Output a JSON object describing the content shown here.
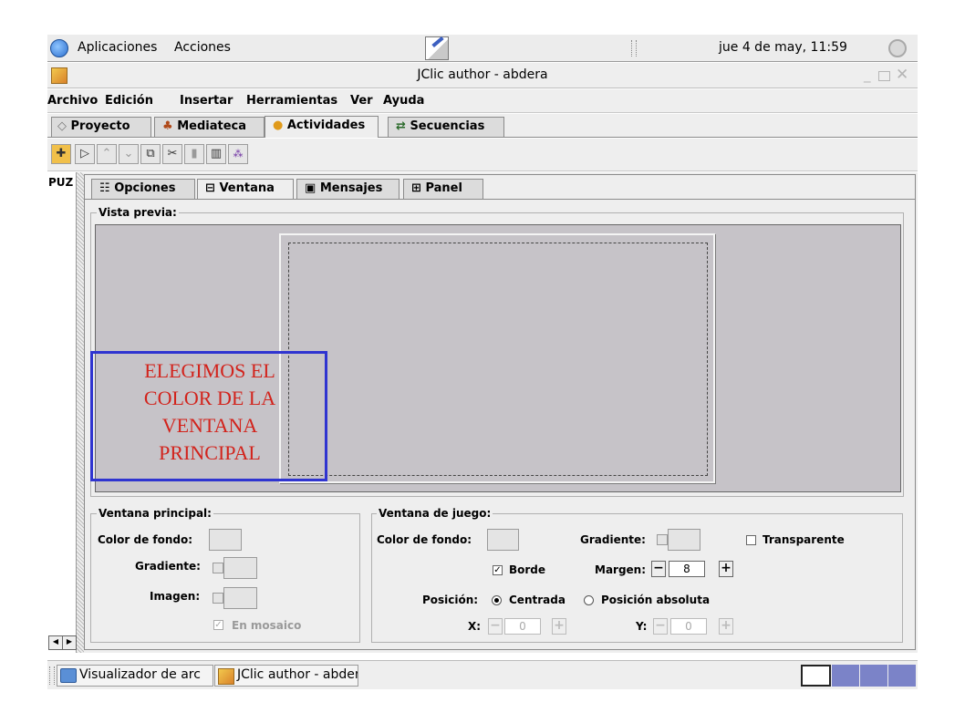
{
  "topbar": {
    "apps": "Aplicaciones",
    "actions": "Acciones",
    "clock": "jue  4 de may, 11:59"
  },
  "window": {
    "title": "JClic author - abdera"
  },
  "menubar": [
    "Archivo",
    "Edición",
    "Insertar",
    "Herramientas",
    "Ver",
    "Ayuda"
  ],
  "main_tabs": [
    {
      "label": "Proyecto",
      "active": false
    },
    {
      "label": "Mediateca",
      "active": false
    },
    {
      "label": "Actividades",
      "active": true
    },
    {
      "label": "Secuencias",
      "active": false
    }
  ],
  "toolbar_icons": [
    "new-activity-icon",
    "play-icon",
    "up-arrow-icon",
    "down-arrow-icon",
    "copy-icon",
    "cut-icon",
    "paste-icon",
    "delete-icon",
    "shuffle-icon"
  ],
  "left_list": {
    "first_item": "PUZ"
  },
  "sub_tabs": [
    {
      "label": "Opciones",
      "active": false
    },
    {
      "label": "Ventana",
      "active": true
    },
    {
      "label": "Mensajes",
      "active": false
    },
    {
      "label": "Panel",
      "active": false
    }
  ],
  "preview": {
    "legend": "Vista previa:",
    "bg_color": "#c6c3c8"
  },
  "annotation": {
    "lines": [
      "ELEGIMOS EL",
      "COLOR DE LA",
      "VENTANA",
      "PRINCIPAL"
    ],
    "text_color": "#d2231c",
    "box_color": "#2f34d0"
  },
  "main_window_group": {
    "legend": "Ventana principal:",
    "bg_color_label": "Color de fondo:",
    "gradient_label": "Gradiente:",
    "image_label": "Imagen:",
    "mosaic_label": "En mosaico",
    "mosaic_checked": true
  },
  "game_window_group": {
    "legend": "Ventana de juego:",
    "bg_color_label": "Color de fondo:",
    "gradient_label": "Gradiente:",
    "transparent_label": "Transparente",
    "border_label": "Borde",
    "border_checked": true,
    "margin_label": "Margen:",
    "margin_value": "8",
    "position_label": "Posición:",
    "centered_label": "Centrada",
    "absolute_label": "Posición absoluta",
    "x_label": "X:",
    "x_value": "0",
    "y_label": "Y:",
    "y_value": "0"
  },
  "taskbar": {
    "items": [
      "Visualizador de arc",
      "JClic author - abder"
    ]
  }
}
